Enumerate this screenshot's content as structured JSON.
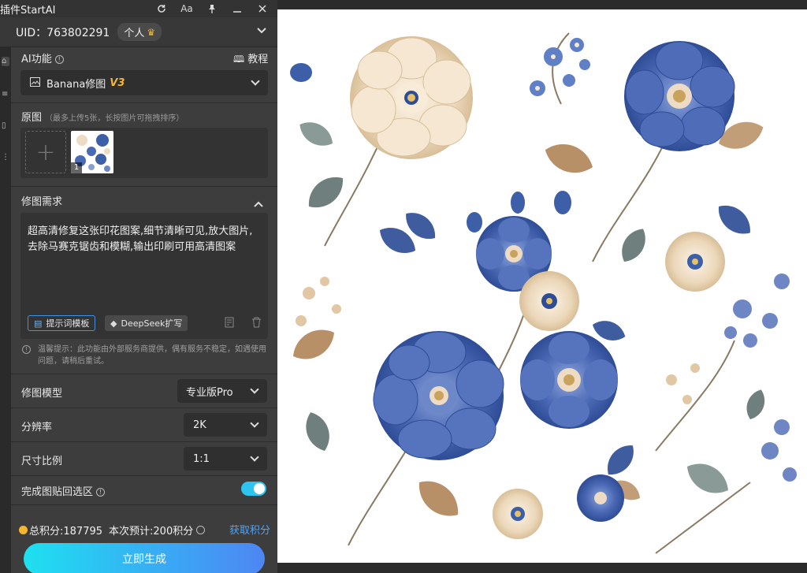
{
  "window": {
    "title": "插件StartAI"
  },
  "titlebar": {
    "refresh_icon": "refresh-icon",
    "font_icon_label": "Aa",
    "pin_icon": "pin-icon",
    "minimize_icon": "minimize-icon",
    "close_icon": "close-icon"
  },
  "account": {
    "uid": "UID：763802291",
    "badge": "个人"
  },
  "ai_function": {
    "label": "AI功能",
    "tutorial": "教程",
    "selected": "Banana修图",
    "version": "V3"
  },
  "upload": {
    "label": "原图",
    "hint": "（最多上传5张，长按图片可拖拽排序）",
    "thumb_index": "1"
  },
  "prompt": {
    "label": "修图需求",
    "text": "超高清修复这张印花图案,细节清晰可见,放大图片,去除马赛克锯齿和模糊,输出印刷可用高清图案",
    "template_button": "提示词模板",
    "deepseek_button": "DeepSeek扩写"
  },
  "notice": "温馨提示：此功能由外部服务商提供，偶有服务不稳定，如遇使用问题，请稍后重试。",
  "settings": {
    "model_label": "修图模型",
    "model_value": "专业版Pro",
    "resolution_label": "分辨率",
    "resolution_value": "2K",
    "ratio_label": "尺寸比例",
    "ratio_value": "1:1",
    "paste_back_label": "完成图贴回选区",
    "paste_back_on": true
  },
  "points": {
    "total": "总积分:187795",
    "estimate": "本次预计:200积分",
    "get_points": "获取积分"
  },
  "generate_button": "立即生成",
  "colors": {
    "accent": "#2ec4f0",
    "link": "#4fa3f7",
    "version": "#f2b632",
    "flower_blue": "#3d5fa8",
    "flower_cream": "#eddcc3",
    "leaf": "#6f7f7e"
  }
}
